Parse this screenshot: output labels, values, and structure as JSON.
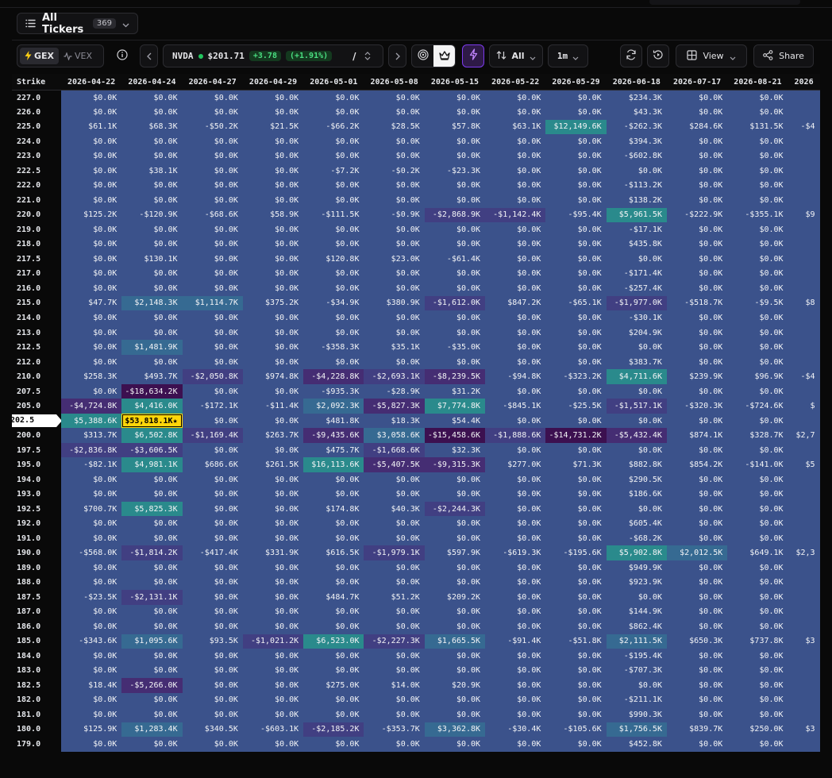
{
  "header": {
    "tickers_label": "All Tickers",
    "tickers_count": "369"
  },
  "toolbar": {
    "gex_label": "GEX",
    "vex_label": "VEX",
    "ticker": "NVDA",
    "price": "$201.71",
    "change": "+3.78",
    "change_pct": "(+1.91%)",
    "slash": "/",
    "all_label": "All",
    "timeframe": "1m",
    "view_label": "View",
    "share_label": "Share"
  },
  "grid": {
    "strike_header": "Strike",
    "current_strike": "202.5",
    "dates": [
      "2026-04-22",
      "2026-04-24",
      "2026-04-27",
      "2026-04-29",
      "2026-05-01",
      "2026-05-08",
      "2026-05-15",
      "2026-05-22",
      "2026-05-29",
      "2026-06-18",
      "2026-07-17",
      "2026-08-21",
      "2026"
    ],
    "rows": [
      {
        "strike": "227.0",
        "cells": [
          "$0.0K",
          "$0.0K",
          "$0.0K",
          "$0.0K",
          "$0.0K",
          "$0.0K",
          "$0.0K",
          "$0.0K",
          "$0.0K",
          "$234.3K",
          "$0.0K",
          "$0.0K",
          ""
        ]
      },
      {
        "strike": "226.0",
        "cells": [
          "$0.0K",
          "$0.0K",
          "$0.0K",
          "$0.0K",
          "$0.0K",
          "$0.0K",
          "$0.0K",
          "$0.0K",
          "$0.0K",
          "$43.3K",
          "$0.0K",
          "$0.0K",
          ""
        ]
      },
      {
        "strike": "225.0",
        "cells": [
          "$61.1K",
          "$68.3K",
          "-$50.2K",
          "$21.5K",
          "-$66.2K",
          "$28.5K",
          "$57.8K",
          "$63.1K",
          "$12,149.6K",
          "-$262.3K",
          "$284.6K",
          "$131.5K",
          "-$4"
        ]
      },
      {
        "strike": "224.0",
        "cells": [
          "$0.0K",
          "$0.0K",
          "$0.0K",
          "$0.0K",
          "$0.0K",
          "$0.0K",
          "$0.0K",
          "$0.0K",
          "$0.0K",
          "$394.3K",
          "$0.0K",
          "$0.0K",
          ""
        ]
      },
      {
        "strike": "223.0",
        "cells": [
          "$0.0K",
          "$0.0K",
          "$0.0K",
          "$0.0K",
          "$0.0K",
          "$0.0K",
          "$0.0K",
          "$0.0K",
          "$0.0K",
          "-$602.8K",
          "$0.0K",
          "$0.0K",
          ""
        ]
      },
      {
        "strike": "222.5",
        "cells": [
          "$0.0K",
          "$38.1K",
          "$0.0K",
          "$0.0K",
          "-$7.2K",
          "-$0.2K",
          "-$23.3K",
          "$0.0K",
          "$0.0K",
          "$0.0K",
          "$0.0K",
          "$0.0K",
          ""
        ]
      },
      {
        "strike": "222.0",
        "cells": [
          "$0.0K",
          "$0.0K",
          "$0.0K",
          "$0.0K",
          "$0.0K",
          "$0.0K",
          "$0.0K",
          "$0.0K",
          "$0.0K",
          "-$113.2K",
          "$0.0K",
          "$0.0K",
          ""
        ]
      },
      {
        "strike": "221.0",
        "cells": [
          "$0.0K",
          "$0.0K",
          "$0.0K",
          "$0.0K",
          "$0.0K",
          "$0.0K",
          "$0.0K",
          "$0.0K",
          "$0.0K",
          "$138.2K",
          "$0.0K",
          "$0.0K",
          ""
        ]
      },
      {
        "strike": "220.0",
        "cells": [
          "$125.2K",
          "-$120.9K",
          "-$68.6K",
          "$58.9K",
          "-$111.5K",
          "-$0.9K",
          "-$2,868.9K",
          "-$1,142.4K",
          "-$95.4K",
          "$5,961.5K",
          "-$222.9K",
          "-$355.1K",
          "$9"
        ]
      },
      {
        "strike": "219.0",
        "cells": [
          "$0.0K",
          "$0.0K",
          "$0.0K",
          "$0.0K",
          "$0.0K",
          "$0.0K",
          "$0.0K",
          "$0.0K",
          "$0.0K",
          "-$17.1K",
          "$0.0K",
          "$0.0K",
          ""
        ]
      },
      {
        "strike": "218.0",
        "cells": [
          "$0.0K",
          "$0.0K",
          "$0.0K",
          "$0.0K",
          "$0.0K",
          "$0.0K",
          "$0.0K",
          "$0.0K",
          "$0.0K",
          "$435.8K",
          "$0.0K",
          "$0.0K",
          ""
        ]
      },
      {
        "strike": "217.5",
        "cells": [
          "$0.0K",
          "$130.1K",
          "$0.0K",
          "$0.0K",
          "$120.8K",
          "$23.0K",
          "-$61.4K",
          "$0.0K",
          "$0.0K",
          "$0.0K",
          "$0.0K",
          "$0.0K",
          ""
        ]
      },
      {
        "strike": "217.0",
        "cells": [
          "$0.0K",
          "$0.0K",
          "$0.0K",
          "$0.0K",
          "$0.0K",
          "$0.0K",
          "$0.0K",
          "$0.0K",
          "$0.0K",
          "-$171.4K",
          "$0.0K",
          "$0.0K",
          ""
        ]
      },
      {
        "strike": "216.0",
        "cells": [
          "$0.0K",
          "$0.0K",
          "$0.0K",
          "$0.0K",
          "$0.0K",
          "$0.0K",
          "$0.0K",
          "$0.0K",
          "$0.0K",
          "-$257.4K",
          "$0.0K",
          "$0.0K",
          ""
        ]
      },
      {
        "strike": "215.0",
        "cells": [
          "$47.7K",
          "$2,148.3K",
          "$1,114.7K",
          "$375.2K",
          "-$34.9K",
          "$380.9K",
          "-$1,612.0K",
          "$847.2K",
          "-$65.1K",
          "-$1,977.0K",
          "-$518.7K",
          "-$9.5K",
          "$8"
        ]
      },
      {
        "strike": "214.0",
        "cells": [
          "$0.0K",
          "$0.0K",
          "$0.0K",
          "$0.0K",
          "$0.0K",
          "$0.0K",
          "$0.0K",
          "$0.0K",
          "$0.0K",
          "-$30.1K",
          "$0.0K",
          "$0.0K",
          ""
        ]
      },
      {
        "strike": "213.0",
        "cells": [
          "$0.0K",
          "$0.0K",
          "$0.0K",
          "$0.0K",
          "$0.0K",
          "$0.0K",
          "$0.0K",
          "$0.0K",
          "$0.0K",
          "$204.9K",
          "$0.0K",
          "$0.0K",
          ""
        ]
      },
      {
        "strike": "212.5",
        "cells": [
          "$0.0K",
          "$1,481.9K",
          "$0.0K",
          "$0.0K",
          "-$358.3K",
          "$35.1K",
          "-$35.0K",
          "$0.0K",
          "$0.0K",
          "$0.0K",
          "$0.0K",
          "$0.0K",
          ""
        ]
      },
      {
        "strike": "212.0",
        "cells": [
          "$0.0K",
          "$0.0K",
          "$0.0K",
          "$0.0K",
          "$0.0K",
          "$0.0K",
          "$0.0K",
          "$0.0K",
          "$0.0K",
          "$383.7K",
          "$0.0K",
          "$0.0K",
          ""
        ]
      },
      {
        "strike": "210.0",
        "cells": [
          "$258.3K",
          "$493.7K",
          "-$2,050.8K",
          "$974.8K",
          "-$4,228.8K",
          "-$2,693.1K",
          "-$8,239.5K",
          "-$94.8K",
          "-$323.2K",
          "$4,711.6K",
          "$239.9K",
          "$96.9K",
          "-$4"
        ]
      },
      {
        "strike": "207.5",
        "cells": [
          "$0.0K",
          "-$18,634.2K",
          "$0.0K",
          "$0.0K",
          "-$935.3K",
          "-$28.9K",
          "$31.2K",
          "$0.0K",
          "$0.0K",
          "$0.0K",
          "$0.0K",
          "$0.0K",
          ""
        ]
      },
      {
        "strike": "205.0",
        "cells": [
          "-$4,724.8K",
          "$4,416.0K",
          "-$172.1K",
          "-$11.4K",
          "$2,092.3K",
          "-$5,827.3K",
          "$7,774.8K",
          "-$845.1K",
          "-$25.5K",
          "-$1,517.1K",
          "-$320.3K",
          "-$724.6K",
          "$"
        ]
      },
      {
        "strike": "202.5",
        "cells": [
          "$5,388.6K",
          "$53,818.1K★",
          "$0.0K",
          "$0.0K",
          "$481.8K",
          "$18.3K",
          "$54.4K",
          "$0.0K",
          "$0.0K",
          "$0.0K",
          "$0.0K",
          "$0.0K",
          ""
        ]
      },
      {
        "strike": "200.0",
        "cells": [
          "$313.7K",
          "$6,502.8K",
          "-$1,169.4K",
          "$263.7K",
          "-$9,435.6K",
          "$3,058.6K",
          "-$15,458.6K",
          "-$1,888.6K",
          "-$14,731.2K",
          "-$5,432.4K",
          "$874.1K",
          "$328.7K",
          "$2,7"
        ]
      },
      {
        "strike": "197.5",
        "cells": [
          "-$2,836.8K",
          "-$3,606.5K",
          "$0.0K",
          "$0.0K",
          "$475.7K",
          "-$1,668.6K",
          "$32.3K",
          "$0.0K",
          "$0.0K",
          "$0.0K",
          "$0.0K",
          "$0.0K",
          ""
        ]
      },
      {
        "strike": "195.0",
        "cells": [
          "-$82.1K",
          "$4,981.1K",
          "$686.6K",
          "$261.5K",
          "$16,113.6K",
          "-$5,407.5K",
          "-$9,315.3K",
          "$277.0K",
          "$71.3K",
          "$882.8K",
          "$854.2K",
          "-$141.0K",
          "$5"
        ]
      },
      {
        "strike": "194.0",
        "cells": [
          "$0.0K",
          "$0.0K",
          "$0.0K",
          "$0.0K",
          "$0.0K",
          "$0.0K",
          "$0.0K",
          "$0.0K",
          "$0.0K",
          "$290.5K",
          "$0.0K",
          "$0.0K",
          ""
        ]
      },
      {
        "strike": "193.0",
        "cells": [
          "$0.0K",
          "$0.0K",
          "$0.0K",
          "$0.0K",
          "$0.0K",
          "$0.0K",
          "$0.0K",
          "$0.0K",
          "$0.0K",
          "$186.6K",
          "$0.0K",
          "$0.0K",
          ""
        ]
      },
      {
        "strike": "192.5",
        "cells": [
          "$700.7K",
          "$5,825.3K",
          "$0.0K",
          "$0.0K",
          "$174.8K",
          "$40.3K",
          "-$2,244.3K",
          "$0.0K",
          "$0.0K",
          "$0.0K",
          "$0.0K",
          "$0.0K",
          ""
        ]
      },
      {
        "strike": "192.0",
        "cells": [
          "$0.0K",
          "$0.0K",
          "$0.0K",
          "$0.0K",
          "$0.0K",
          "$0.0K",
          "$0.0K",
          "$0.0K",
          "$0.0K",
          "$605.4K",
          "$0.0K",
          "$0.0K",
          ""
        ]
      },
      {
        "strike": "191.0",
        "cells": [
          "$0.0K",
          "$0.0K",
          "$0.0K",
          "$0.0K",
          "$0.0K",
          "$0.0K",
          "$0.0K",
          "$0.0K",
          "$0.0K",
          "-$68.2K",
          "$0.0K",
          "$0.0K",
          ""
        ]
      },
      {
        "strike": "190.0",
        "cells": [
          "-$568.0K",
          "-$1,814.2K",
          "-$417.4K",
          "$331.9K",
          "$616.5K",
          "-$1,979.1K",
          "$597.9K",
          "-$619.3K",
          "-$195.6K",
          "$5,902.8K",
          "$2,012.5K",
          "$649.1K",
          "$2,3"
        ]
      },
      {
        "strike": "189.0",
        "cells": [
          "$0.0K",
          "$0.0K",
          "$0.0K",
          "$0.0K",
          "$0.0K",
          "$0.0K",
          "$0.0K",
          "$0.0K",
          "$0.0K",
          "$949.9K",
          "$0.0K",
          "$0.0K",
          ""
        ]
      },
      {
        "strike": "188.0",
        "cells": [
          "$0.0K",
          "$0.0K",
          "$0.0K",
          "$0.0K",
          "$0.0K",
          "$0.0K",
          "$0.0K",
          "$0.0K",
          "$0.0K",
          "$923.9K",
          "$0.0K",
          "$0.0K",
          ""
        ]
      },
      {
        "strike": "187.5",
        "cells": [
          "-$23.5K",
          "-$2,131.1K",
          "$0.0K",
          "$0.0K",
          "$484.7K",
          "$51.2K",
          "$209.2K",
          "$0.0K",
          "$0.0K",
          "$0.0K",
          "$0.0K",
          "$0.0K",
          ""
        ]
      },
      {
        "strike": "187.0",
        "cells": [
          "$0.0K",
          "$0.0K",
          "$0.0K",
          "$0.0K",
          "$0.0K",
          "$0.0K",
          "$0.0K",
          "$0.0K",
          "$0.0K",
          "$144.9K",
          "$0.0K",
          "$0.0K",
          ""
        ]
      },
      {
        "strike": "186.0",
        "cells": [
          "$0.0K",
          "$0.0K",
          "$0.0K",
          "$0.0K",
          "$0.0K",
          "$0.0K",
          "$0.0K",
          "$0.0K",
          "$0.0K",
          "$862.4K",
          "$0.0K",
          "$0.0K",
          ""
        ]
      },
      {
        "strike": "185.0",
        "cells": [
          "-$343.6K",
          "$1,095.6K",
          "$93.5K",
          "-$1,021.2K",
          "$6,523.0K",
          "-$2,227.3K",
          "$1,665.5K",
          "-$91.4K",
          "-$51.8K",
          "$2,111.5K",
          "$650.3K",
          "$737.8K",
          "$3"
        ]
      },
      {
        "strike": "184.0",
        "cells": [
          "$0.0K",
          "$0.0K",
          "$0.0K",
          "$0.0K",
          "$0.0K",
          "$0.0K",
          "$0.0K",
          "$0.0K",
          "$0.0K",
          "-$195.4K",
          "$0.0K",
          "$0.0K",
          ""
        ]
      },
      {
        "strike": "183.0",
        "cells": [
          "$0.0K",
          "$0.0K",
          "$0.0K",
          "$0.0K",
          "$0.0K",
          "$0.0K",
          "$0.0K",
          "$0.0K",
          "$0.0K",
          "-$707.3K",
          "$0.0K",
          "$0.0K",
          ""
        ]
      },
      {
        "strike": "182.5",
        "cells": [
          "$18.4K",
          "-$5,266.0K",
          "$0.0K",
          "$0.0K",
          "$275.0K",
          "$14.0K",
          "$20.9K",
          "$0.0K",
          "$0.0K",
          "$0.0K",
          "$0.0K",
          "$0.0K",
          ""
        ]
      },
      {
        "strike": "182.0",
        "cells": [
          "$0.0K",
          "$0.0K",
          "$0.0K",
          "$0.0K",
          "$0.0K",
          "$0.0K",
          "$0.0K",
          "$0.0K",
          "$0.0K",
          "-$211.1K",
          "$0.0K",
          "$0.0K",
          ""
        ]
      },
      {
        "strike": "181.0",
        "cells": [
          "$0.0K",
          "$0.0K",
          "$0.0K",
          "$0.0K",
          "$0.0K",
          "$0.0K",
          "$0.0K",
          "$0.0K",
          "$0.0K",
          "$990.3K",
          "$0.0K",
          "$0.0K",
          ""
        ]
      },
      {
        "strike": "180.0",
        "cells": [
          "$125.9K",
          "$1,283.4K",
          "$340.5K",
          "-$603.1K",
          "-$2,185.2K",
          "-$353.7K",
          "$3,362.8K",
          "-$30.4K",
          "-$105.6K",
          "$1,756.5K",
          "$839.7K",
          "$250.0K",
          "$3"
        ]
      },
      {
        "strike": "179.0",
        "cells": [
          "$0.0K",
          "$0.0K",
          "$0.0K",
          "$0.0K",
          "$0.0K",
          "$0.0K",
          "$0.0K",
          "$0.0K",
          "$0.0K",
          "$452.8K",
          "$0.0K",
          "$0.0K",
          ""
        ]
      }
    ]
  }
}
